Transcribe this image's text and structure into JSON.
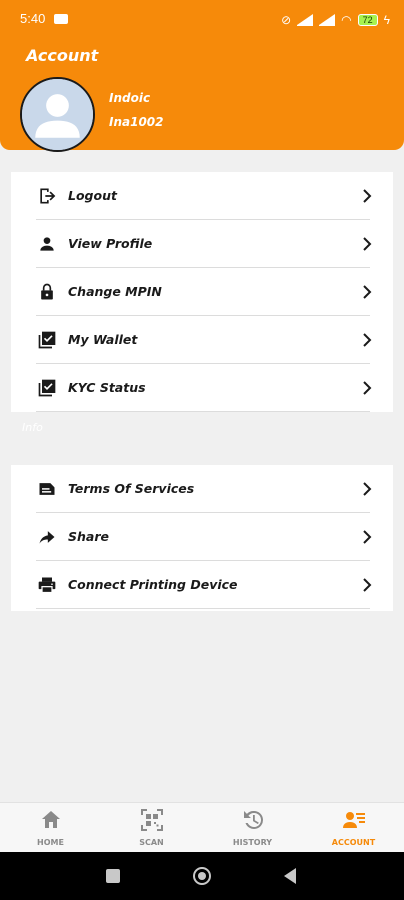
{
  "status_bar": {
    "time": "5:40",
    "battery": "72"
  },
  "header": {
    "title": "Account",
    "user_name": "Indoic",
    "user_id": "Ina1002"
  },
  "menu_main": [
    {
      "label": "Logout",
      "icon": "logout-icon"
    },
    {
      "label": "View Profile",
      "icon": "person-icon"
    },
    {
      "label": "Change MPIN",
      "icon": "lock-icon"
    },
    {
      "label": "My Wallet",
      "icon": "checkbox-icon"
    },
    {
      "label": "KYC Status",
      "icon": "checkbox-icon"
    }
  ],
  "section_label": "Info",
  "menu_info": [
    {
      "label": "Terms Of Services",
      "icon": "document-icon"
    },
    {
      "label": "Share",
      "icon": "share-icon"
    },
    {
      "label": "Connect Printing Device",
      "icon": "printer-icon"
    }
  ],
  "bottom_nav": [
    {
      "label": "HOME",
      "icon": "home-icon",
      "active": false
    },
    {
      "label": "SCAN",
      "icon": "qr-scan-icon",
      "active": false
    },
    {
      "label": "HISTORY",
      "icon": "history-icon",
      "active": false
    },
    {
      "label": "ACCOUNT",
      "icon": "account-list-icon",
      "active": true
    }
  ],
  "colors": {
    "accent": "#f68a0a",
    "text": "#1a1a1a",
    "inactive": "#8a8a8a"
  }
}
